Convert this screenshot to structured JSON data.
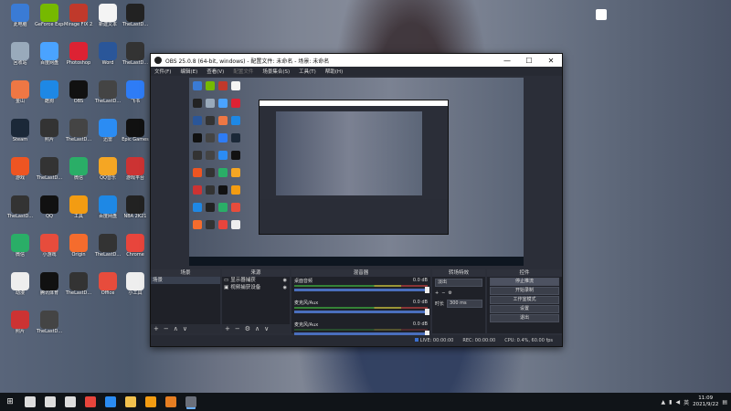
{
  "desktop": {
    "icons": [
      {
        "label": "此电脑",
        "color": "#3a7bd5"
      },
      {
        "label": "GeForce Experience",
        "color": "#76b900"
      },
      {
        "label": "Mirage FIX 2.0",
        "color": "#c0392b"
      },
      {
        "label": "新建文本",
        "color": "#f4f4f4"
      },
      {
        "label": "TheLastD...",
        "color": "#222"
      },
      {
        "label": "回收站",
        "color": "#9ab"
      },
      {
        "label": "百度网盘",
        "color": "#4aa3ff"
      },
      {
        "label": "Photoshop",
        "color": "#d23"
      },
      {
        "label": "Word",
        "color": "#2a5699"
      },
      {
        "label": "TheLastD...",
        "color": "#333"
      },
      {
        "label": "金山",
        "color": "#e74"
      },
      {
        "label": "酷狗",
        "color": "#1e88e5"
      },
      {
        "label": "OBS",
        "color": "#111"
      },
      {
        "label": "TheLastD...",
        "color": "#444"
      },
      {
        "label": "飞书",
        "color": "#2e7cf6"
      },
      {
        "label": "Steam",
        "color": "#1b2838"
      },
      {
        "label": "照片",
        "color": "#333"
      },
      {
        "label": "TheLastD...",
        "color": "#444"
      },
      {
        "label": "迅雷",
        "color": "#2b8cf3"
      },
      {
        "label": "Epic Games",
        "color": "#111"
      },
      {
        "label": "游戏",
        "color": "#e52"
      },
      {
        "label": "TheLastD...",
        "color": "#333"
      },
      {
        "label": "微信",
        "color": "#2aae67"
      },
      {
        "label": "QQ音乐",
        "color": "#f5a623"
      },
      {
        "label": "游戏平台",
        "color": "#c33"
      },
      {
        "label": "TheLastD...",
        "color": "#333"
      },
      {
        "label": "QQ",
        "color": "#111"
      },
      {
        "label": "工具",
        "color": "#f39c12"
      },
      {
        "label": "百度网盘",
        "color": "#1e88e5"
      },
      {
        "label": "NBA 2K21",
        "color": "#222"
      },
      {
        "label": "微信",
        "color": "#2aae67"
      },
      {
        "label": "小游戏",
        "color": "#e74c3c"
      },
      {
        "label": "Origin",
        "color": "#f56c2d"
      },
      {
        "label": "TheLastD...",
        "color": "#333"
      },
      {
        "label": "Chrome",
        "color": "#e8453c"
      },
      {
        "label": "动漫",
        "color": "#eee"
      },
      {
        "label": "腾讯体育",
        "color": "#111"
      },
      {
        "label": "TheLastD...",
        "color": "#333"
      },
      {
        "label": "Office",
        "color": "#e74c3c"
      },
      {
        "label": "小工具",
        "color": "#eee"
      },
      {
        "label": "照片",
        "color": "#c33"
      },
      {
        "label": "TheLastD...",
        "color": "#444"
      }
    ]
  },
  "obs": {
    "title": "OBS 25.0.8 (64-bit, windows) - 配置文件: 未命名 - 场景: 未命名",
    "window_controls": [
      "—",
      "☐",
      "✕"
    ],
    "menu": [
      "文件(F)",
      "编辑(E)",
      "查看(V)",
      "配置文件",
      "场景集合(S)",
      "工具(T)",
      "帮助(H)"
    ],
    "dock_titles": {
      "scenes": "场景",
      "sources": "来源",
      "mixer": "混音器",
      "transitions": "转场特效",
      "controls": "控件"
    },
    "scenes": [
      "场景"
    ],
    "sources": [
      {
        "label": "显示器捕获"
      },
      {
        "label": "视频捕获设备"
      }
    ],
    "mixer": [
      {
        "name": "桌面音频",
        "db": "0.0 dB",
        "level": 0.62
      },
      {
        "name": "麦克风/Aux",
        "db": "0.0 dB",
        "level": 0.3
      },
      {
        "name": "麦克风/Aux",
        "db": "0.0 dB",
        "level": 0.0
      }
    ],
    "transitions": {
      "type": "淡出",
      "duration_label": "时长",
      "duration": "300 ms"
    },
    "controls": [
      "停止推流",
      "开始录制",
      "工作室模式",
      "设置",
      "退出"
    ],
    "status": {
      "live": "LIVE: 00:00:00",
      "rec": "REC: 00:00:00",
      "cpu": "CPU: 0.4%, 60.00 fps"
    },
    "dock_buttons": {
      "add": "+",
      "remove": "−",
      "settings": "⚙",
      "up": "∧",
      "down": "∨"
    }
  },
  "taskbar": {
    "start_icon": "windows-icon",
    "clock_time": "11:09",
    "clock_date": "2021/9/22",
    "ime": "英",
    "apps": [
      {
        "name": "search",
        "color": "#ddd"
      },
      {
        "name": "cortana",
        "color": "#ddd"
      },
      {
        "name": "taskview",
        "color": "#ddd"
      },
      {
        "name": "chrome",
        "color": "#e8453c"
      },
      {
        "name": "qqbrowser",
        "color": "#2b8cf3"
      },
      {
        "name": "explorer",
        "color": "#f2c14e"
      },
      {
        "name": "sublime",
        "color": "#f39c12"
      },
      {
        "name": "office",
        "color": "#e67e22"
      },
      {
        "name": "obs",
        "color": "#6a6f7a"
      }
    ]
  }
}
